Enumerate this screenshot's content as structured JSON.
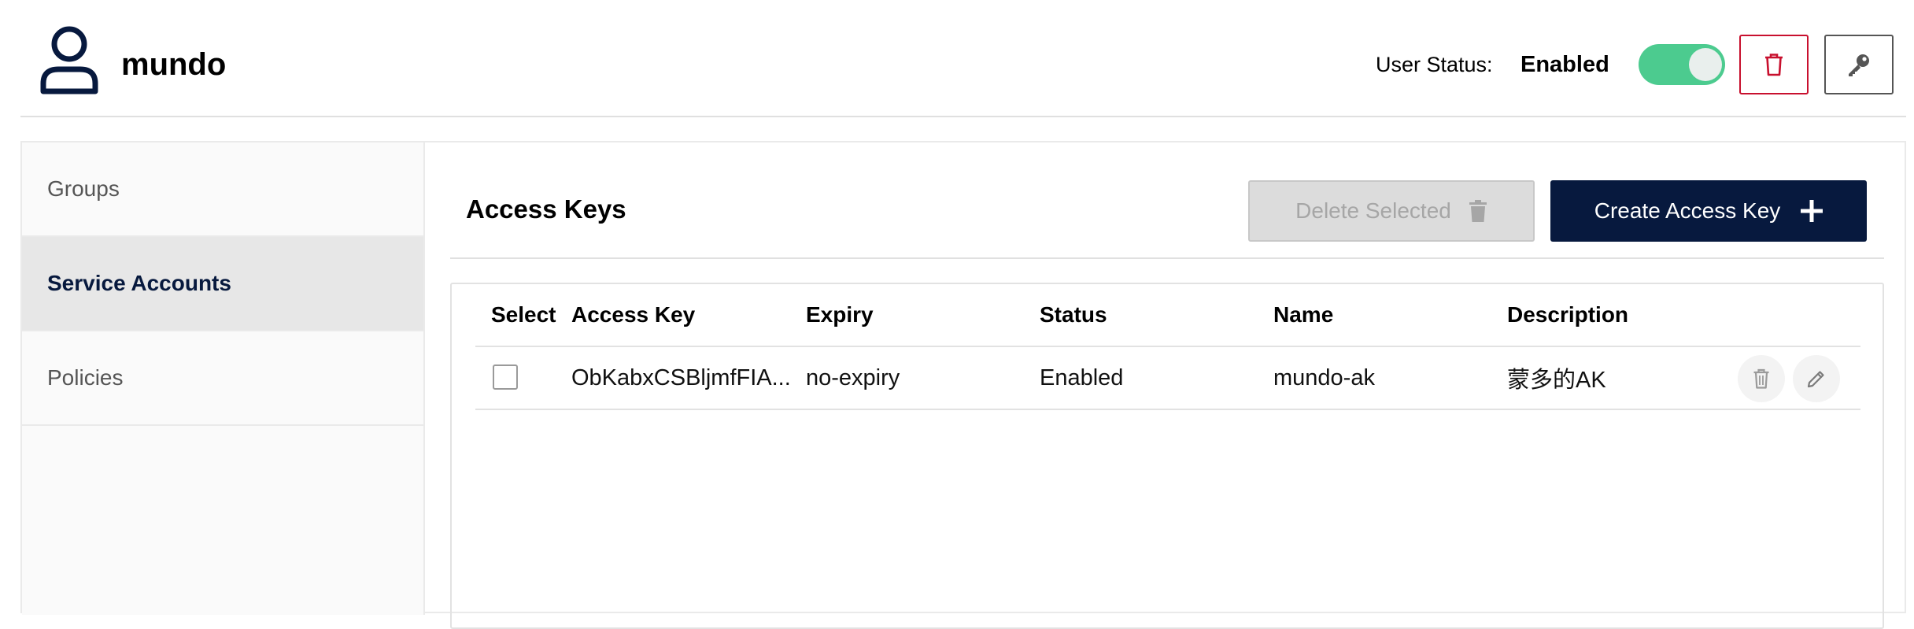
{
  "header": {
    "username": "mundo",
    "status_label": "User Status:",
    "status_value": "Enabled",
    "status_enabled": true
  },
  "sidebar": {
    "items": [
      {
        "label": "Groups",
        "active": false
      },
      {
        "label": "Service Accounts",
        "active": true
      },
      {
        "label": "Policies",
        "active": false
      }
    ]
  },
  "main": {
    "title": "Access Keys",
    "delete_selected_label": "Delete Selected",
    "create_label": "Create Access Key",
    "table": {
      "columns": [
        "Select",
        "Access Key",
        "Expiry",
        "Status",
        "Name",
        "Description"
      ],
      "rows": [
        {
          "selected": false,
          "access_key": "ObKabxCSBljmfFIA...",
          "expiry": "no-expiry",
          "status": "Enabled",
          "name": "mundo-ak",
          "description": "蒙多的AK"
        }
      ]
    }
  },
  "icons": {
    "avatar": "user-outline-icon",
    "delete_user": "trash-icon",
    "change_password": "key-icon",
    "delete_selected": "trash-filled-icon",
    "create": "plus-icon",
    "row_delete": "trash-icon",
    "row_edit": "pencil-icon"
  },
  "colors": {
    "primary": "#07193e",
    "toggle_on": "#4ccb8f",
    "danger": "#c8102e",
    "disabled_bg": "#dcdcdc"
  }
}
